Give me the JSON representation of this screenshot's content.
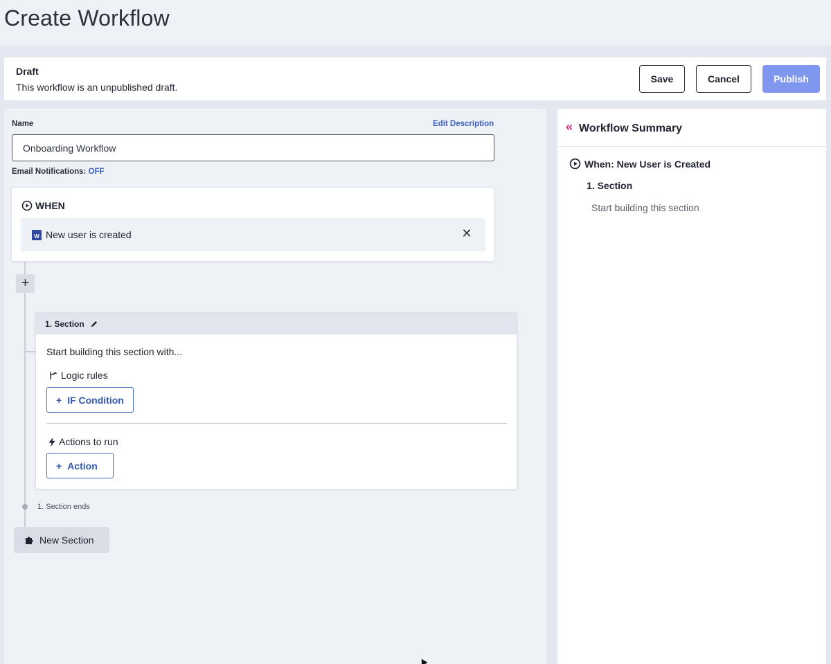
{
  "page": {
    "title": "Create Workflow"
  },
  "draft": {
    "title": "Draft",
    "description": "This workflow is an unpublished draft.",
    "save_label": "Save",
    "cancel_label": "Cancel",
    "publish_label": "Publish"
  },
  "form": {
    "name_label": "Name",
    "edit_description_label": "Edit Description",
    "name_value": "Onboarding Workflow",
    "email_notifications_label": "Email Notifications:",
    "email_notifications_value": "OFF"
  },
  "when": {
    "heading": "WHEN",
    "trigger": "New user is created",
    "app_badge": "W",
    "icons": {
      "play": "play-circle-icon",
      "close": "close-icon",
      "add": "plus-icon"
    }
  },
  "section": {
    "title": "1. Section",
    "start_text": "Start building this section with...",
    "logic_label": "Logic rules",
    "if_condition_label": "IF Condition",
    "actions_label": "Actions to run",
    "action_label": "Action",
    "ends_label": "1. Section ends",
    "icons": {
      "edit": "pencil-icon",
      "logic": "branch-icon",
      "actions": "lightning-icon"
    }
  },
  "new_section": {
    "label": "New Section",
    "icon": "puzzle-icon"
  },
  "summary": {
    "title": "Workflow Summary",
    "when_text": "When: New User is Created",
    "section_title": "1. Section",
    "start_text": "Start building this section",
    "collapse_icon": "double-chevron-left-icon"
  },
  "colors": {
    "accent_blue": "#3a5fbf",
    "publish_button": "#7f97ef",
    "collapse_pink": "#d4347a",
    "panel_bg": "#eef1f6"
  }
}
